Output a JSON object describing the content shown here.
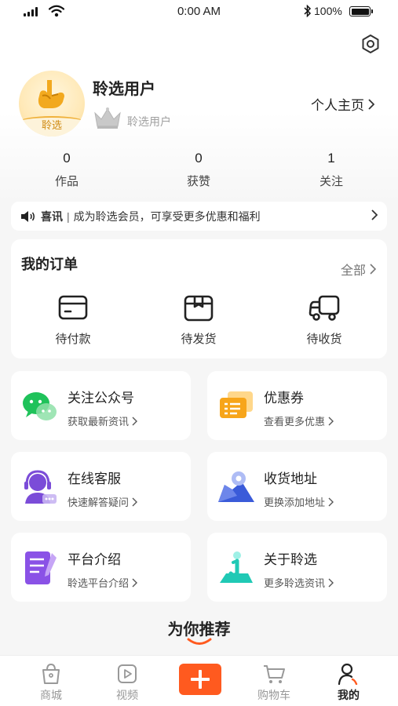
{
  "status_bar": {
    "time": "0:00 AM",
    "battery": "100%"
  },
  "profile": {
    "avatar_label": "聆选",
    "name": "聆选用户",
    "level": "聆选用户",
    "homepage_link": "个人主页"
  },
  "stats": [
    {
      "value": "0",
      "label": "作品"
    },
    {
      "value": "0",
      "label": "获赞"
    },
    {
      "value": "1",
      "label": "关注"
    }
  ],
  "notice": {
    "tag": "喜讯",
    "separator": "|",
    "text": "成为聆选会员，可享受更多优惠和福利"
  },
  "orders": {
    "title": "我的订单",
    "all_label": "全部",
    "items": [
      {
        "label": "待付款",
        "icon": "wallet-icon"
      },
      {
        "label": "待发货",
        "icon": "package-icon"
      },
      {
        "label": "待收货",
        "icon": "truck-icon"
      }
    ]
  },
  "tiles": [
    {
      "title": "关注公众号",
      "subtitle": "获取最新资讯",
      "icon": "wechat-icon"
    },
    {
      "title": "优惠券",
      "subtitle": "查看更多优惠",
      "icon": "coupon-icon"
    },
    {
      "title": "在线客服",
      "subtitle": "快速解答疑问",
      "icon": "customer-service-icon"
    },
    {
      "title": "收货地址",
      "subtitle": "更换添加地址",
      "icon": "location-icon"
    },
    {
      "title": "平台介绍",
      "subtitle": "聆选平台介绍",
      "icon": "document-icon"
    },
    {
      "title": "关于聆选",
      "subtitle": "更多聆选资讯",
      "icon": "info-icon"
    }
  ],
  "recommend_title": "为你推荐",
  "tabbar": [
    {
      "label": "商城",
      "icon": "shopping-bag-icon"
    },
    {
      "label": "视频",
      "icon": "video-icon"
    },
    {
      "label": "",
      "icon": "plus-icon"
    },
    {
      "label": "购物车",
      "icon": "cart-icon"
    },
    {
      "label": "我的",
      "icon": "user-icon",
      "active": true
    }
  ],
  "colors": {
    "accent": "#ff5a1f",
    "gold": "#f0b23c",
    "background": "#f6f6f6"
  }
}
